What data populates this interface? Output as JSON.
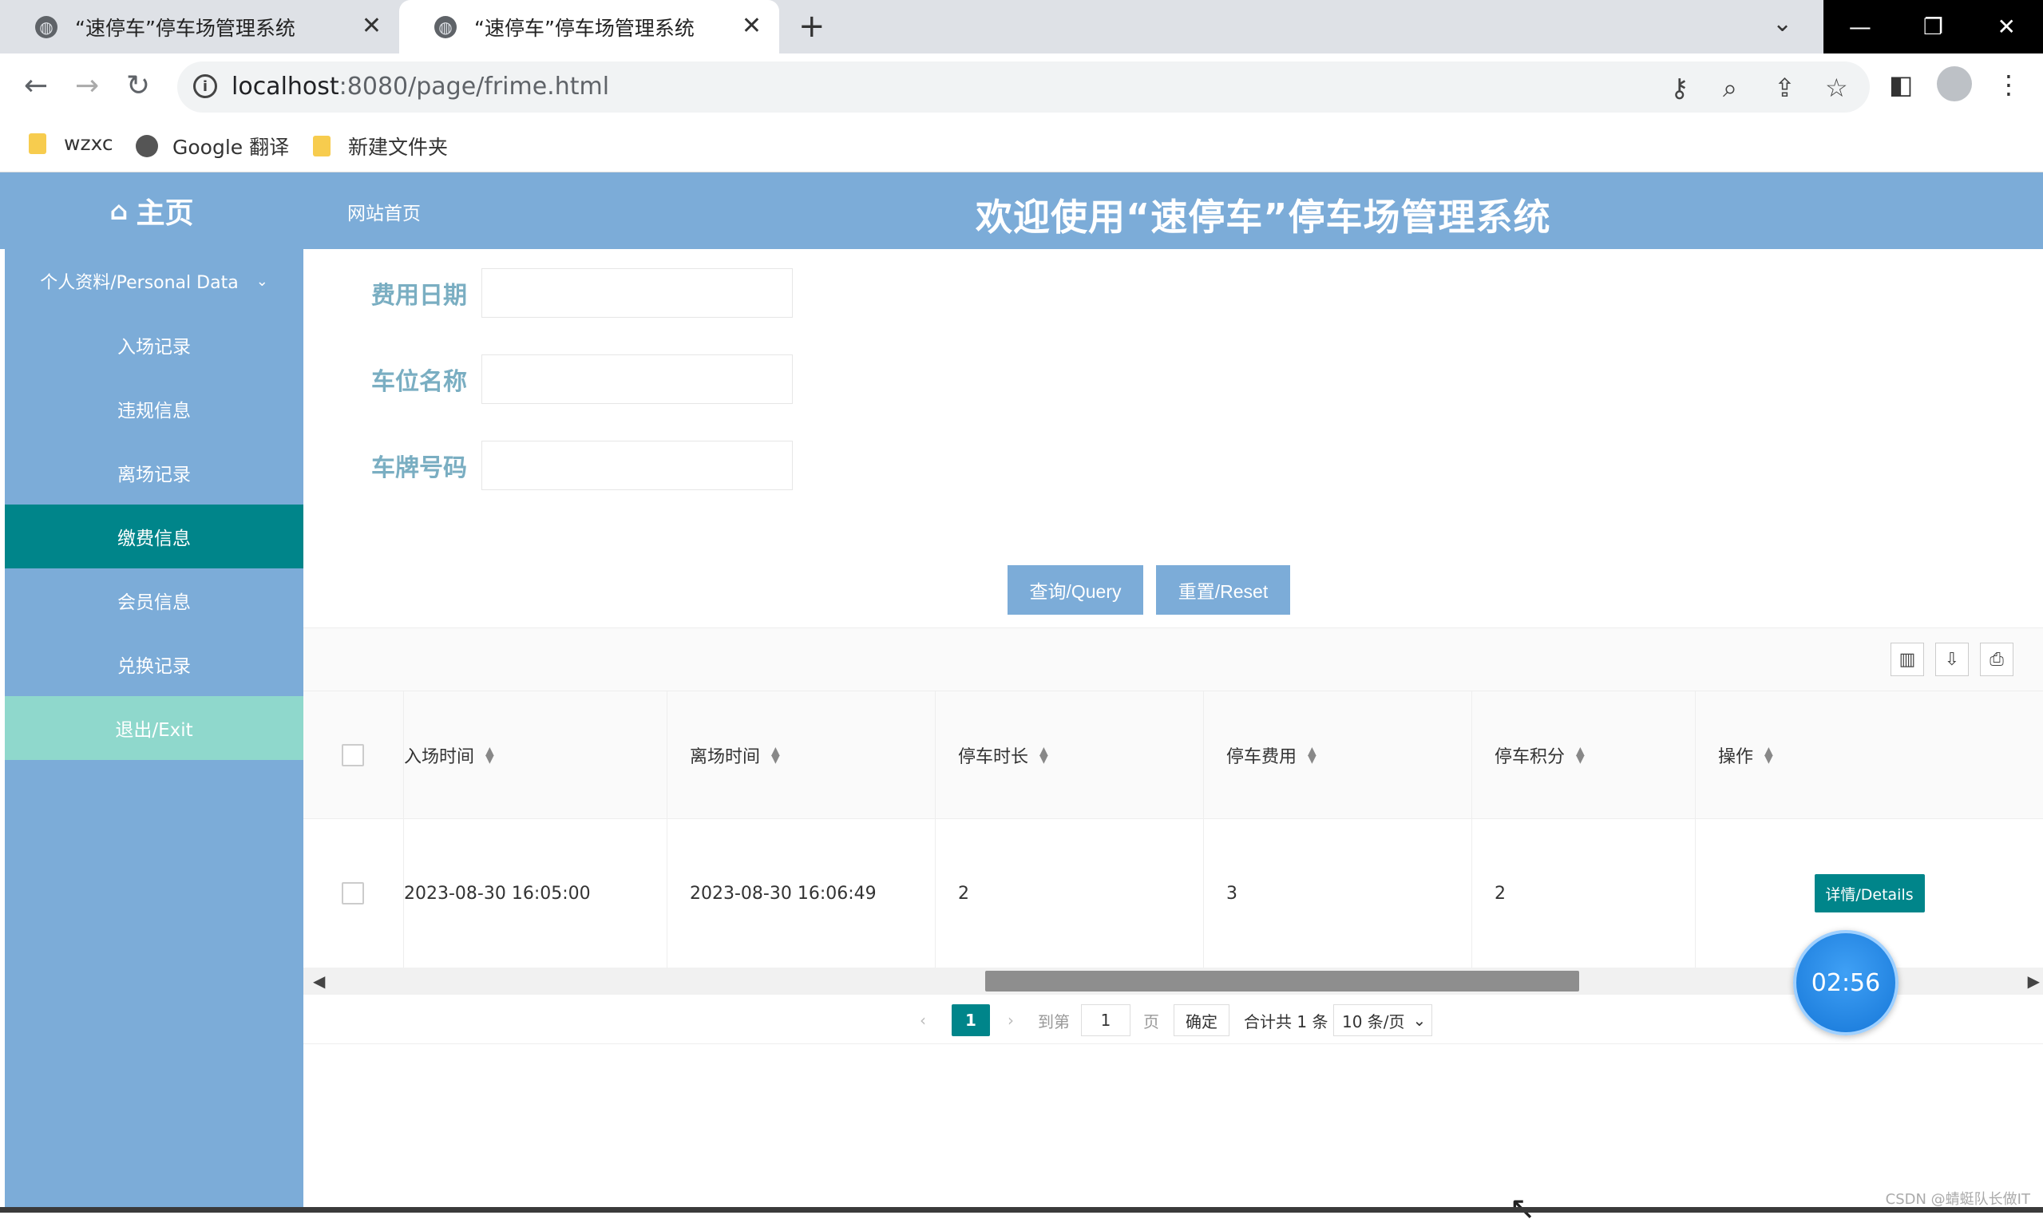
{
  "browser": {
    "tabs": [
      {
        "title": "“速停车”停车场管理系统"
      },
      {
        "title": "“速停车”停车场管理系统"
      }
    ],
    "url_host": "localhost",
    "url_rest": ":8080/page/frime.html",
    "bookmarks": [
      "wzxc",
      "Google 翻译",
      "新建文件夹"
    ]
  },
  "header": {
    "home_label": "主页",
    "site_home": "网站首页",
    "title": "欢迎使用“速停车”停车场管理系统"
  },
  "sidebar": {
    "group": "个人资料/Personal Data",
    "items": [
      {
        "label": "入场记录"
      },
      {
        "label": "违规信息"
      },
      {
        "label": "离场记录"
      },
      {
        "label": "缴费信息"
      },
      {
        "label": "会员信息"
      },
      {
        "label": "兑换记录"
      },
      {
        "label": "退出/Exit"
      }
    ],
    "active_index": 3
  },
  "form": {
    "fields": [
      {
        "label": "费用日期",
        "value": ""
      },
      {
        "label": "车位名称",
        "value": ""
      },
      {
        "label": "车牌号码",
        "value": ""
      }
    ],
    "query_label": "查询/Query",
    "reset_label": "重置/Reset"
  },
  "table": {
    "columns": [
      "入场时间",
      "离场时间",
      "停车时长",
      "停车费用",
      "停车积分",
      "操作"
    ],
    "rows": [
      {
        "entry_time": "2023-08-30 16:05:00",
        "exit_time": "2023-08-30 16:06:49",
        "duration": "2",
        "fee": "3",
        "points": "2",
        "action": "详情/Details"
      }
    ]
  },
  "pagination": {
    "current_page": "1",
    "goto_label": "到第",
    "goto_value": "1",
    "page_unit": "页",
    "confirm": "确定",
    "total": "合计共 1 条",
    "page_size": "10 条/页"
  },
  "timer": "02:56",
  "watermark": "CSDN @蜻蜓队长做IT",
  "colors": {
    "header": "#7cacd8",
    "active": "#00858a",
    "exit": "#8fd8cc",
    "label": "#7aaec2"
  }
}
